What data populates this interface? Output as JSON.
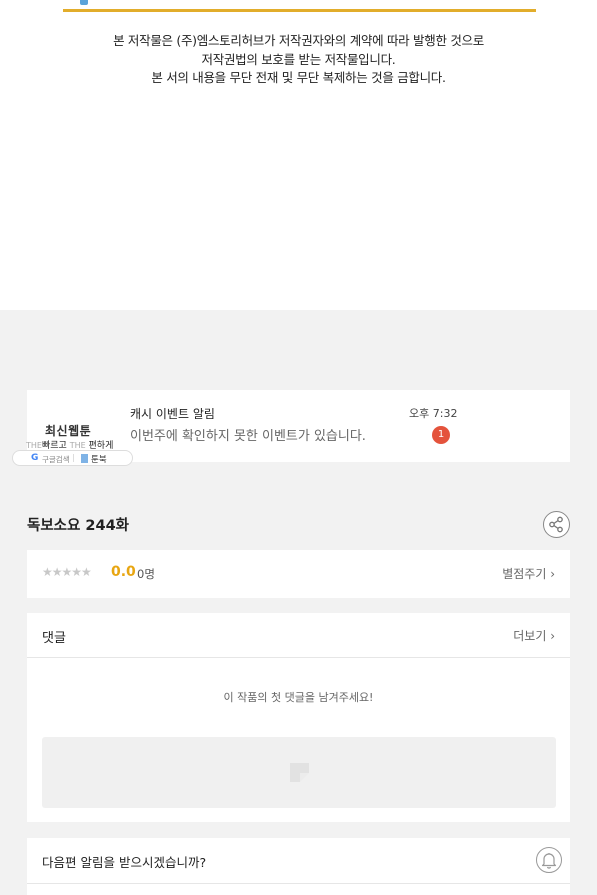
{
  "copyright": {
    "lines": [
      "본 저작물은 (주)엠스토리허브가 저작권자와의 계약에 따라 발행한 것으로",
      "저작권법의 보호를 받는 저작물입니다.",
      "본 서의 내용을 무단 전재 및 무단 복제하는 것을 금합니다."
    ],
    "bar_color": "#e2ad2b"
  },
  "brand": {
    "name": "최신웹툰",
    "slogan_the1": "THE",
    "slogan_word1": "빠르고",
    "slogan_the2": "THE",
    "slogan_word2": "편하게",
    "google_label": "구글검색",
    "book_label": "툰북"
  },
  "notification": {
    "title": "캐시 이벤트 알림",
    "message": "이번주에 확인하지 못한 이벤트가 있습니다.",
    "time": "오후 7:32",
    "badge_count": "1",
    "badge_color": "#e4533c"
  },
  "episode": {
    "title": "독보소요 244화",
    "share_icon": "share-icon"
  },
  "rating": {
    "stars": "★★★★★",
    "star_value": 0.0,
    "score": "0.0",
    "count": "0명",
    "rate_link": "별점주기 ›",
    "score_color": "#e8a612"
  },
  "comments": {
    "label": "댓글",
    "more_link": "더보기 ›",
    "empty_message": "이 작품의 첫 댓글을 남겨주세요!"
  },
  "next_alarm": {
    "question": "다음편 알림을 받으시겠습니까?",
    "bell_icon": "bell-icon"
  }
}
